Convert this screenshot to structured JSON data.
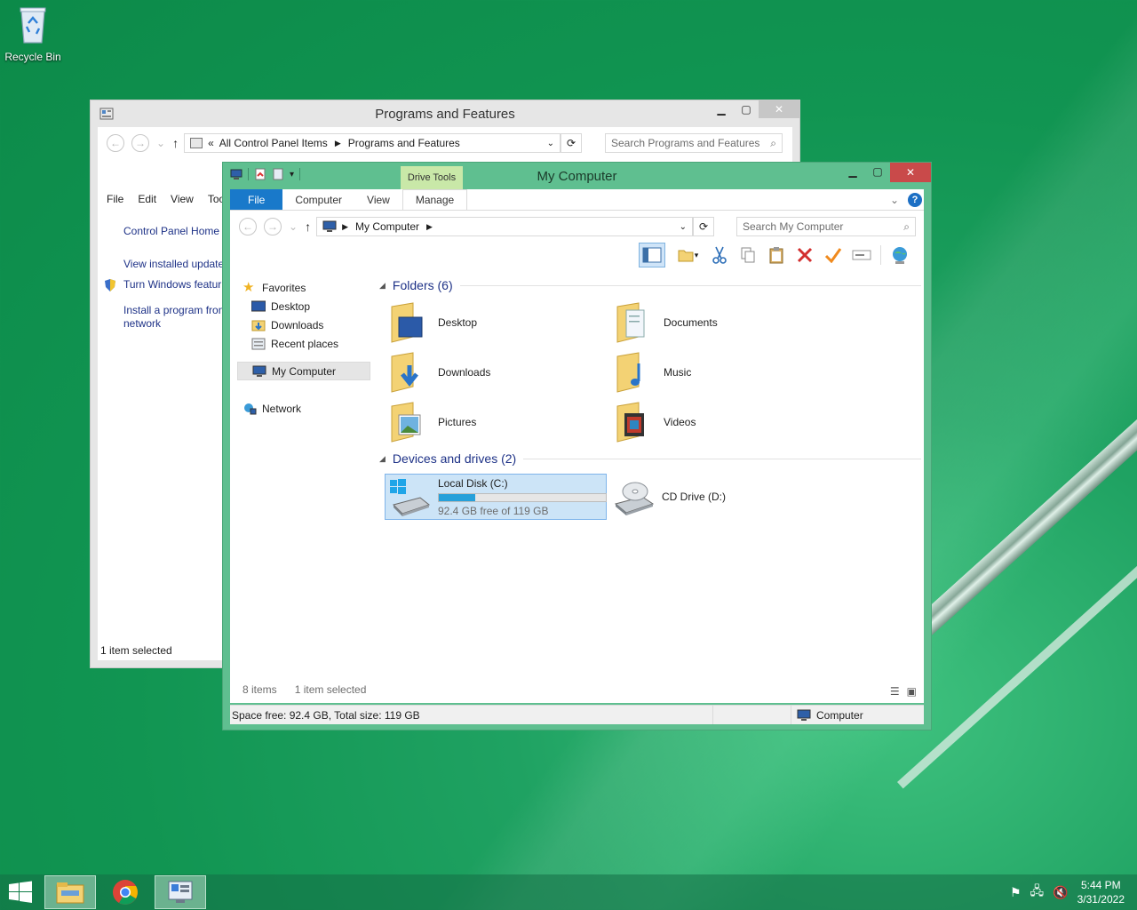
{
  "desktop": {
    "recycle_bin_label": "Recycle Bin"
  },
  "programs_window": {
    "title": "Programs and Features",
    "address": {
      "prefix": "«",
      "crumb1": "All Control Panel Items",
      "crumb2": "Programs and Features"
    },
    "search_placeholder": "Search Programs and Features",
    "menu": [
      "File",
      "Edit",
      "View",
      "Too"
    ],
    "left_links": {
      "home": "Control Panel Home",
      "updates": "View installed update",
      "features": "Turn Windows featur off",
      "install": "Install a program fron network"
    },
    "status": "1 item selected"
  },
  "computer_window": {
    "title": "My Computer",
    "contextual_tab": "Drive Tools",
    "ribbon_tabs": {
      "file": "File",
      "computer": "Computer",
      "view": "View",
      "manage": "Manage"
    },
    "address_crumb": "My Computer",
    "search_placeholder": "Search My Computer",
    "nav": {
      "favorites": "Favorites",
      "desktop": "Desktop",
      "downloads": "Downloads",
      "recent": "Recent places",
      "my_computer": "My Computer",
      "network": "Network"
    },
    "folders_heading": "Folders (6)",
    "folders": {
      "desktop": "Desktop",
      "documents": "Documents",
      "downloads": "Downloads",
      "music": "Music",
      "pictures": "Pictures",
      "videos": "Videos"
    },
    "devices_heading": "Devices and drives (2)",
    "drives": {
      "c_name": "Local Disk (C:)",
      "c_free": "92.4 GB free of 119 GB",
      "c_used_fraction": 0.22,
      "d_name": "CD Drive (D:)"
    },
    "status_items": "8 items",
    "status_selected": "1 item selected",
    "details_bar": "Space free: 92.4 GB, Total size: 119 GB",
    "details_location": "Computer"
  },
  "taskbar": {
    "time": "5:44 PM",
    "date": "3/31/2022"
  },
  "colors": {
    "desktop_green": "#119552",
    "window_frame": "#5fbf90",
    "file_tab": "#1979ca",
    "close_button": "#c94a4a"
  }
}
